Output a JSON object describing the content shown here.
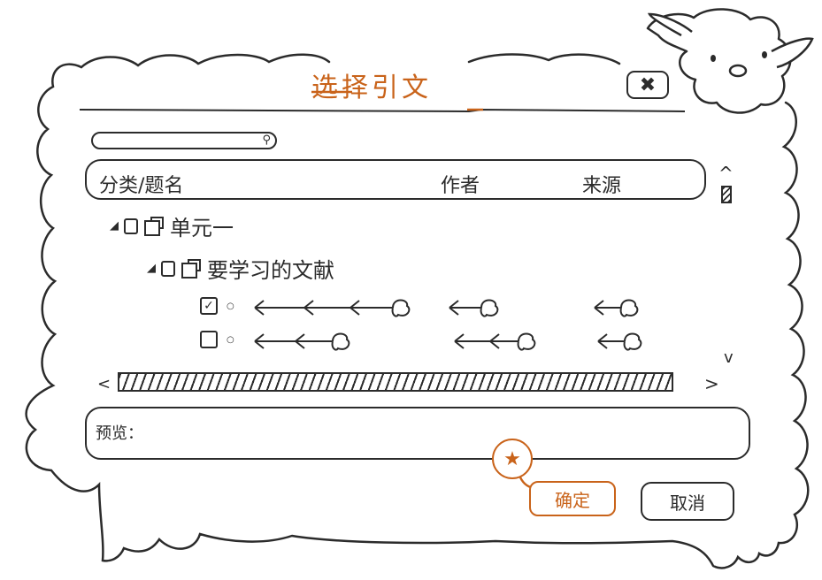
{
  "dialog": {
    "title": "选择引文",
    "close_icon": "close-icon"
  },
  "search": {
    "value": "",
    "placeholder": "",
    "icon": "search-icon"
  },
  "table": {
    "columns": [
      "分类/题名",
      "作者",
      "来源"
    ]
  },
  "tree": [
    {
      "label": "单元一",
      "level": 1,
      "checked": false,
      "icon": "folder-icon"
    },
    {
      "label": "要学习的文献",
      "level": 2,
      "checked": false,
      "icon": "folder-icon"
    }
  ],
  "rows": [
    {
      "checked": true
    },
    {
      "checked": false
    }
  ],
  "preview": {
    "label": "预览："
  },
  "buttons": {
    "ok_label": "确定",
    "cancel_label": "取消"
  },
  "colors": {
    "accent": "#c9631a",
    "ink": "#2b2b2b",
    "background": "#ffffff"
  }
}
